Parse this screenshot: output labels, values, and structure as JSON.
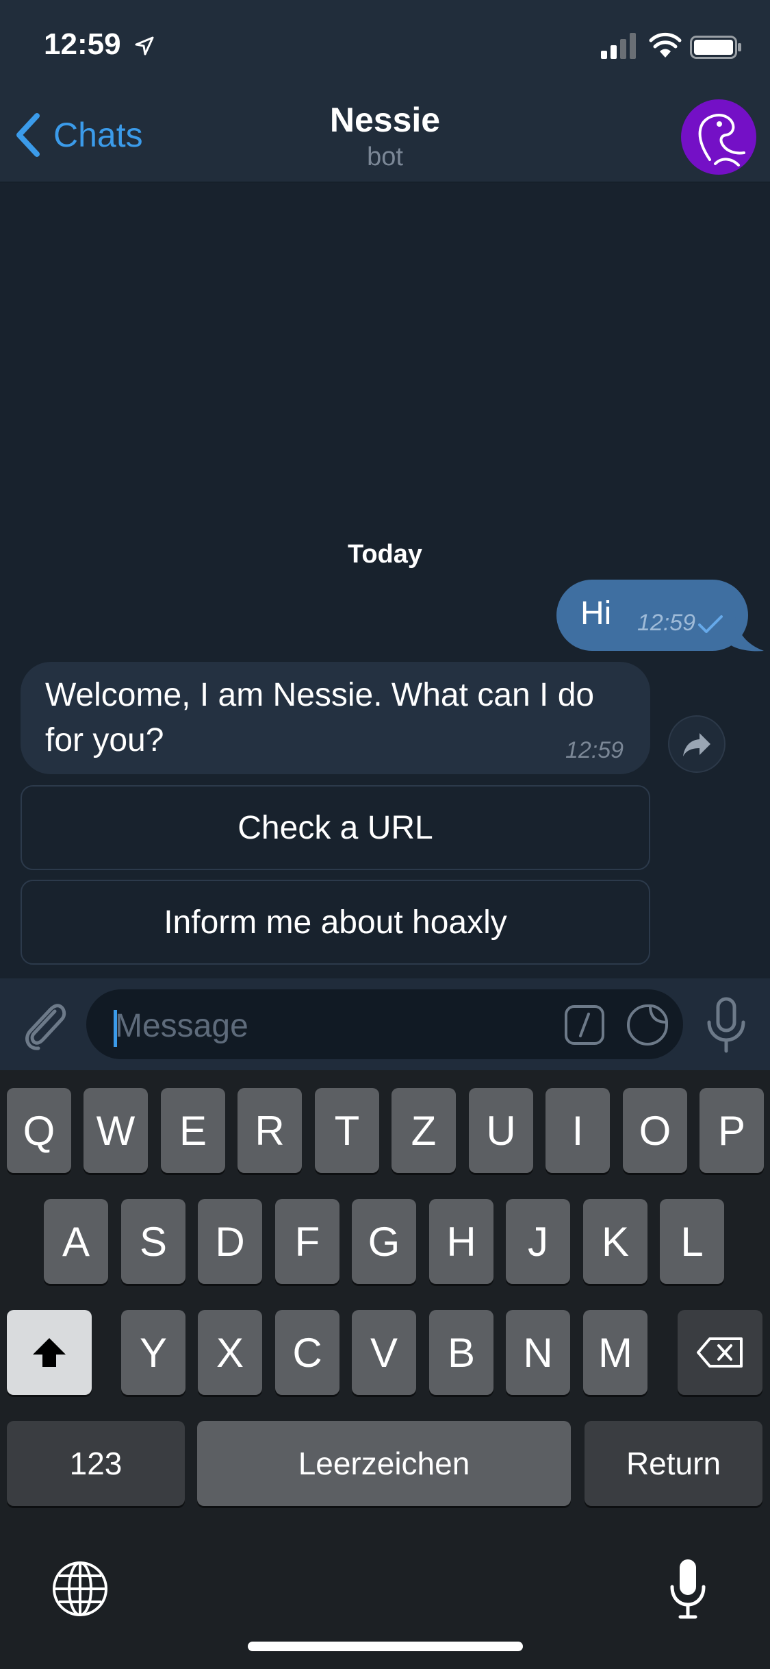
{
  "status_bar": {
    "time": "12:59"
  },
  "header": {
    "back_label": "Chats",
    "title": "Nessie",
    "subtitle": "bot"
  },
  "chat": {
    "date_label": "Today",
    "messages": [
      {
        "direction": "outgoing",
        "text": "Hi",
        "time": "12:59",
        "status": "sent"
      },
      {
        "direction": "incoming",
        "text": "Welcome, I am Nessie. What can I do for you?",
        "time": "12:59"
      }
    ],
    "inline_keyboard": [
      {
        "label": "Check a URL"
      },
      {
        "label": "Inform me about hoaxly"
      }
    ]
  },
  "composer": {
    "placeholder": "Message"
  },
  "keyboard": {
    "row1": [
      "Q",
      "W",
      "E",
      "R",
      "T",
      "Z",
      "U",
      "I",
      "O",
      "P"
    ],
    "row2": [
      "A",
      "S",
      "D",
      "F",
      "G",
      "H",
      "J",
      "K",
      "L"
    ],
    "row3": [
      "Y",
      "X",
      "C",
      "V",
      "B",
      "N",
      "M"
    ],
    "numbers_label": "123",
    "space_label": "Leerzeichen",
    "return_label": "Return"
  },
  "colors": {
    "accent": "#3b9bea",
    "background": "#18222d",
    "header": "#212d3b",
    "outgoing_bubble": "#3f6fa1",
    "incoming_bubble": "#243141",
    "avatar": "#7410c6"
  },
  "icons": [
    "location-arrow-icon",
    "signal-icon",
    "wifi-icon",
    "battery-icon",
    "chevron-left-icon",
    "nessie-avatar",
    "check-icon",
    "share-icon",
    "paperclip-icon",
    "slash-command-icon",
    "sticker-icon",
    "microphone-icon",
    "shift-icon",
    "backspace-icon",
    "globe-icon",
    "dictation-icon"
  ]
}
